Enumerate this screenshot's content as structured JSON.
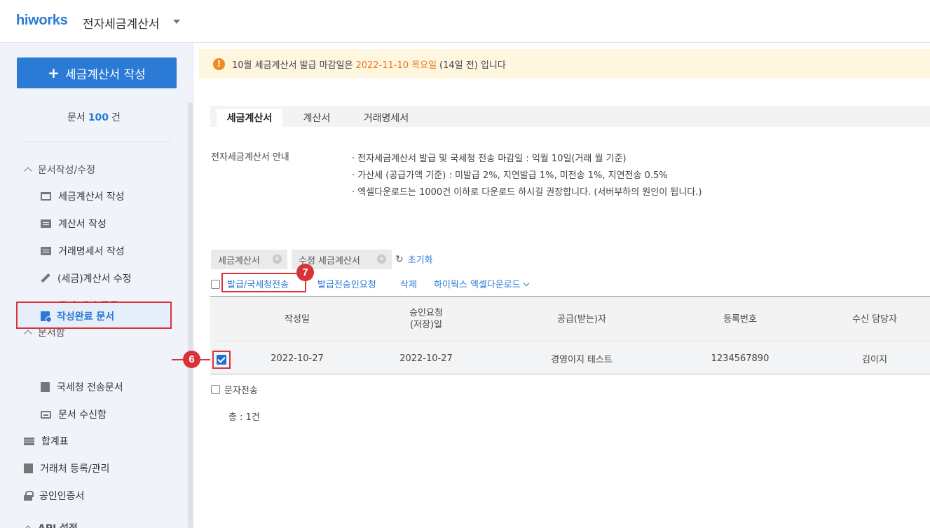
{
  "header": {
    "logo": "hiworks",
    "app_title": "전자세금계산서"
  },
  "sidebar": {
    "create_button": "세금계산서 작성",
    "doc_count_prefix": "문서",
    "doc_count": "100",
    "doc_count_suffix": "건",
    "sections": {
      "write_edit": "문서작성/수정",
      "docbox": "문서함",
      "api": "API 설정"
    },
    "items": {
      "write_tax": "세금계산서 작성",
      "write_bill": "계산서 작성",
      "write_trade": "거래명세서 작성",
      "edit_tax": "(세금)계산서 수정",
      "bulk_register": "문서 대량 등록",
      "completed": "작성완료 문서",
      "nts_sent": "국세청 전송문서",
      "received": "문서 수신함",
      "summary": "합계표",
      "partners": "거래처 등록/관리",
      "certificate": "공인인증서"
    }
  },
  "markers": {
    "m6": "6",
    "m7": "7"
  },
  "notice": {
    "prefix": "10월 세금계산서 발급 마감일은",
    "date": "2022-11-10 목요일",
    "suffix": "(14일 전) 입니다"
  },
  "tabs": [
    "세금계산서",
    "계산서",
    "거래명세서"
  ],
  "guide": {
    "label": "전자세금계산서 안내",
    "lines": [
      "· 전자세금계산서 발급 및 국세청 전송 마감일 : 익월 10일(거래 월 기준)",
      "· 가산세 (공급가액 기준) : 미발급 2%, 지연발급 1%, 미전송 1%, 지연전송 0.5%",
      "· 엑셀다운로드는 1000건 이하로 다운로드 하시길 권장합니다. (서버부하의 원인이 됩니다.)"
    ]
  },
  "filters": {
    "chips": [
      "세금계산서",
      "수정 세금계산서"
    ],
    "reset": "초기화"
  },
  "actions": {
    "issue_send": "발급/국세청전송",
    "approval_request": "발급전승인요청",
    "delete": "삭제",
    "excel_download": "하이웍스 엑셀다운로드"
  },
  "table": {
    "headers": [
      "작성일",
      "승인요청\n(저장)일",
      "공급(받는)자",
      "등록번호",
      "수신 담당자"
    ],
    "rows": [
      {
        "written": "2022-10-27",
        "approval": "2022-10-27",
        "supplier": "경영이지 테스트",
        "reg_no": "1234567890",
        "receiver": "김이지"
      }
    ]
  },
  "sms_label": "문자전송",
  "total": "총 : 1건",
  "colors": {
    "brand": "#2a7ad6",
    "highlight": "#d9333a",
    "warning": "#ee8a1e"
  }
}
